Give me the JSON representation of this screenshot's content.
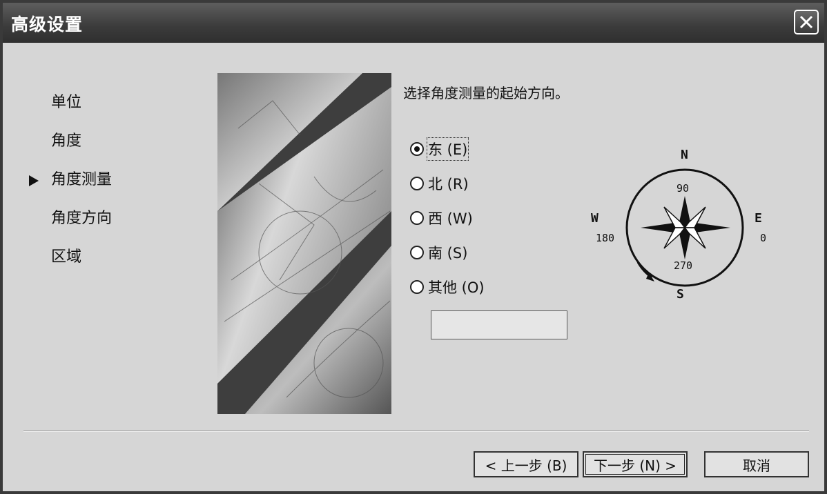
{
  "window": {
    "title": "高级设置"
  },
  "nav": {
    "items": [
      {
        "label": "单位"
      },
      {
        "label": "角度"
      },
      {
        "label": "角度测量",
        "current": true
      },
      {
        "label": "角度方向"
      },
      {
        "label": "区域"
      }
    ]
  },
  "main": {
    "instruction": "选择角度测量的起始方向。",
    "options": [
      {
        "label": "东 (E)",
        "checked": true
      },
      {
        "label": "北 (R)",
        "checked": false
      },
      {
        "label": "西 (W)",
        "checked": false
      },
      {
        "label": "南 (S)",
        "checked": false
      },
      {
        "label": "其他 (O)",
        "checked": false
      }
    ],
    "other_value": ""
  },
  "compass": {
    "north": "N",
    "south": "S",
    "west": "W",
    "east": "E",
    "deg_top": "90",
    "deg_left": "180",
    "deg_right": "0",
    "deg_bottom": "270"
  },
  "buttons": {
    "back": "< 上一步 (B)",
    "next": "下一步 (N) >",
    "cancel": "取消"
  },
  "icons": {
    "close": "close-icon",
    "current_step": "arrow-right-icon"
  }
}
